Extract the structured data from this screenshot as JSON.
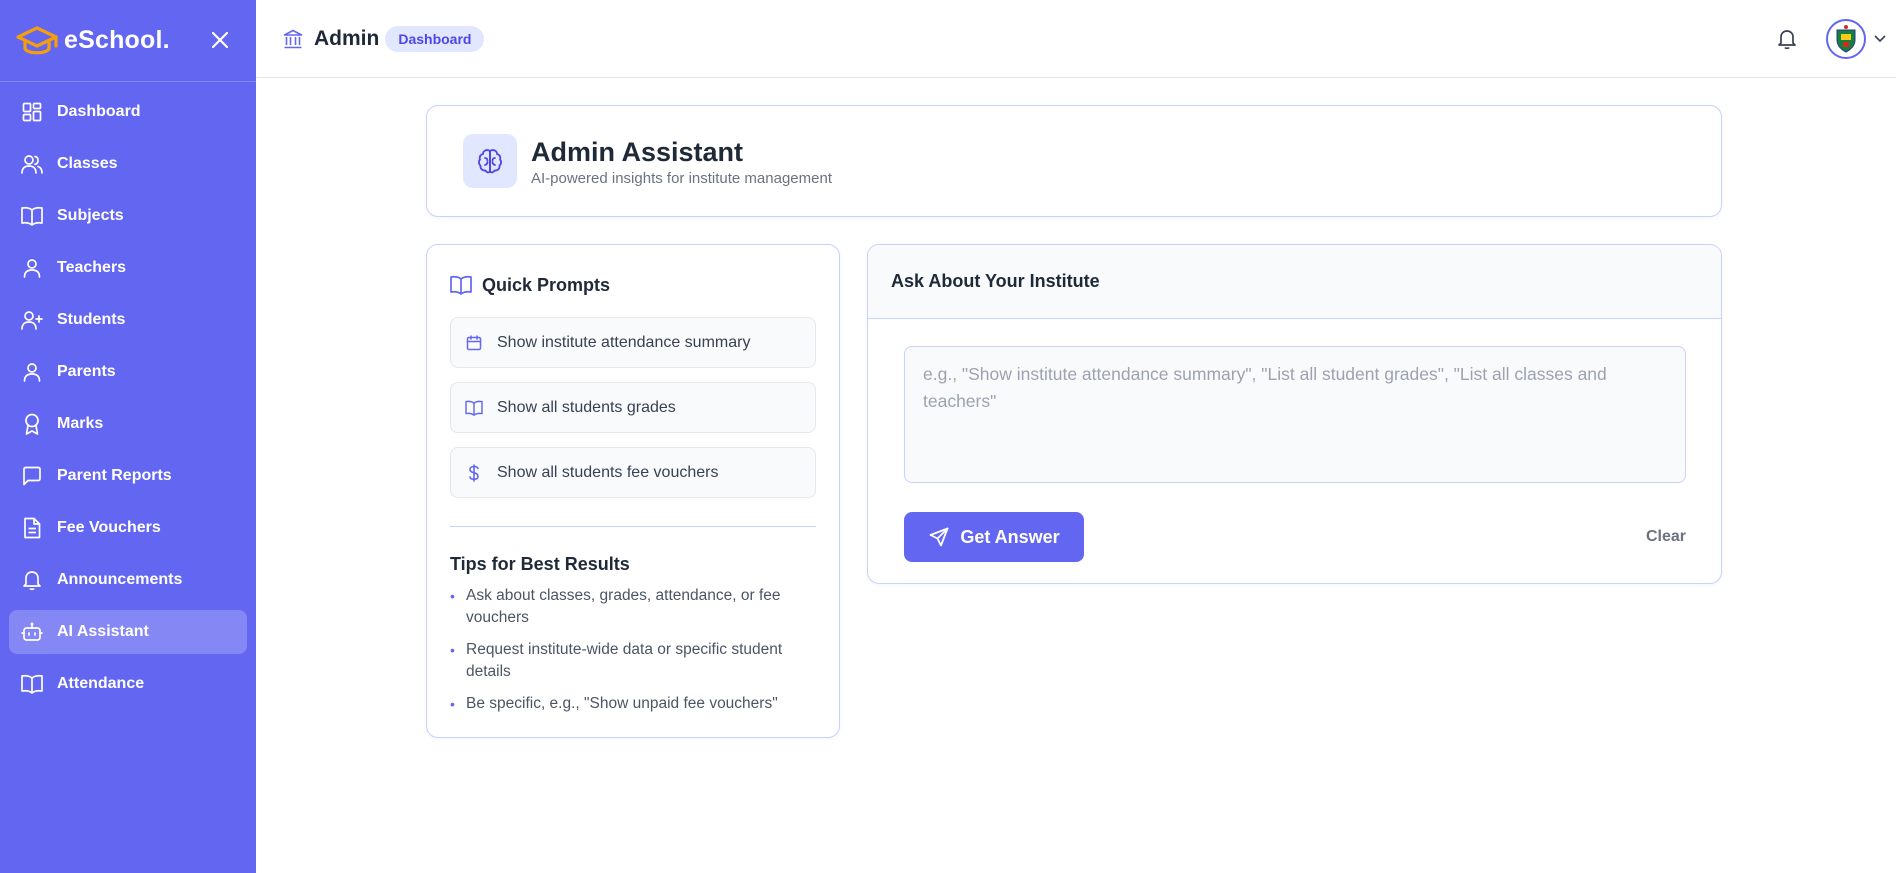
{
  "brand": {
    "name": "eSchool.",
    "logo_icon": "graduation-cap-icon",
    "accent_color": "#f59e0b"
  },
  "colors": {
    "primary": "#6366f1",
    "primary_light": "#e0e7ff",
    "border": "#c7d2fe"
  },
  "sidebar": {
    "items": [
      {
        "label": "Dashboard",
        "icon": "dashboard-icon",
        "active": false
      },
      {
        "label": "Classes",
        "icon": "users-icon",
        "active": false
      },
      {
        "label": "Subjects",
        "icon": "book-open-icon",
        "active": false
      },
      {
        "label": "Teachers",
        "icon": "user-icon",
        "active": false
      },
      {
        "label": "Students",
        "icon": "user-plus-icon",
        "active": false
      },
      {
        "label": "Parents",
        "icon": "user-icon",
        "active": false
      },
      {
        "label": "Marks",
        "icon": "award-icon",
        "active": false
      },
      {
        "label": "Parent Reports",
        "icon": "message-square-icon",
        "active": false
      },
      {
        "label": "Fee Vouchers",
        "icon": "file-text-icon",
        "active": false
      },
      {
        "label": "Announcements",
        "icon": "bell-icon",
        "active": false
      },
      {
        "label": "AI Assistant",
        "icon": "bot-icon",
        "active": true
      },
      {
        "label": "Attendance",
        "icon": "book-open-icon",
        "active": false
      }
    ]
  },
  "topbar": {
    "title": "Admin",
    "badge": "Dashboard",
    "icon": "building-icon"
  },
  "header_card": {
    "title": "Admin Assistant",
    "subtitle": "AI-powered insights for institute management",
    "icon": "brain-icon"
  },
  "quick_prompts": {
    "title": "Quick Prompts",
    "items": [
      {
        "label": "Show institute attendance summary",
        "icon": "calendar-icon"
      },
      {
        "label": "Show all students grades",
        "icon": "book-open-icon"
      },
      {
        "label": "Show all students fee vouchers",
        "icon": "dollar-sign-icon"
      }
    ],
    "tips_title": "Tips for Best Results",
    "tips": [
      "Ask about classes, grades, attendance, or fee vouchers",
      "Request institute-wide data or specific student details",
      "Be specific, e.g., \"Show unpaid fee vouchers\""
    ]
  },
  "ask": {
    "title": "Ask About Your Institute",
    "placeholder": "e.g., \"Show institute attendance summary\", \"List all student grades\", \"List all classes and teachers\"",
    "value": "",
    "submit_label": "Get Answer",
    "clear_label": "Clear"
  }
}
